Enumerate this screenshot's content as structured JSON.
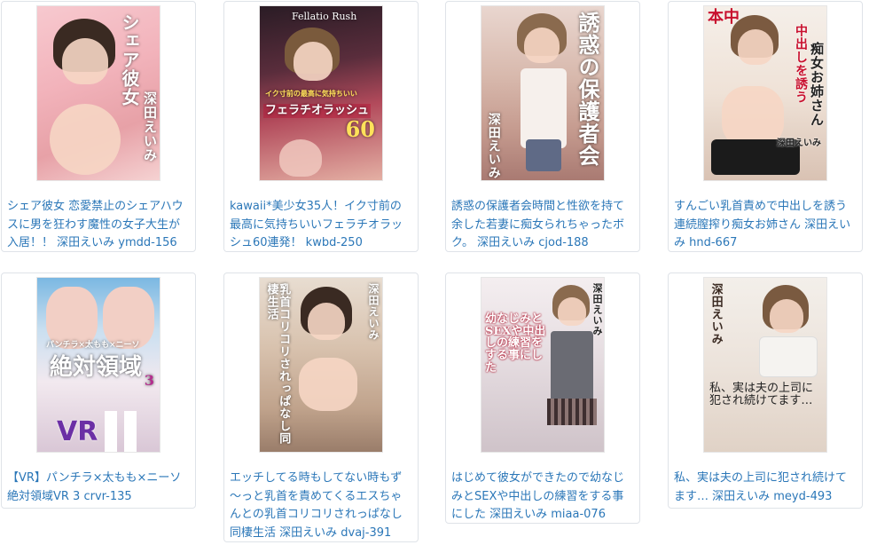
{
  "cards": [
    {
      "caption": "シェア彼女 恋愛禁止のシェアハウスに男を狂わす魔性の女子大生が入居！！ 深田えいみ ymdd-156",
      "cover_text": [
        "シェア彼女",
        "深田えいみ"
      ]
    },
    {
      "caption": "kawaii*美少女35人！イク寸前の最高に気持ちいいフェラチオラッシュ60連発！ kwbd-250",
      "cover_text": [
        "Fellatio Rush",
        "イク寸前の最高に気持ちいい",
        "フェラチオラッシュ",
        "60"
      ]
    },
    {
      "caption": "誘惑の保護者会時間と性欲を持て余した若妻に痴女られちゃったボク。 深田えいみ cjod-188",
      "cover_text": [
        "誘惑の保護者会",
        "深田えいみ"
      ]
    },
    {
      "caption": "すんごい乳首責めで中出しを誘う連続膣搾り痴女お姉さん 深田えいみ hnd-667",
      "cover_text": [
        "本中",
        "中出しを誘う",
        "痴女お姉さん",
        "深田えいみ"
      ]
    },
    {
      "caption": "【VR】パンチラ×太もも×ニーソ 絶対領域VR 3 crvr-135",
      "cover_text": [
        "パンチラ×太もも×ニーソ",
        "絶対領域",
        "VR",
        "3"
      ]
    },
    {
      "caption": "エッチしてる時もしてない時もず～っと乳首を責めてくるエスちゃんとの乳首コリコリされっぱなし同棲生活 深田えいみ dvaj-391",
      "cover_text": [
        "乳首コリコリされっぱなし同棲生活",
        "深田えいみ"
      ]
    },
    {
      "caption": "はじめて彼女ができたので幼なじみとSEXや中出しの練習をする事にした 深田えいみ miaa-076",
      "cover_text": [
        "幼なじみとSEXや中出しの練習をする事にした",
        "深田えいみ"
      ]
    },
    {
      "caption": "私、実は夫の上司に犯され続けてます… 深田えいみ meyd-493",
      "cover_text": [
        "私、実は夫の上司に犯され続けてます…",
        "深田えいみ"
      ]
    }
  ]
}
